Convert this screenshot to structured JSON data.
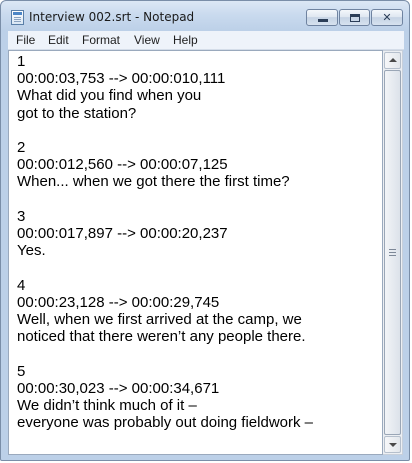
{
  "window": {
    "title": "Interview 002.srt - Notepad",
    "app_icon": "notepad-icon"
  },
  "title_buttons": {
    "minimize_icon": "minimize-icon",
    "maximize_icon": "maximize-icon",
    "close_icon": "close-icon",
    "close_glyph": "✕"
  },
  "menu": {
    "items": [
      {
        "label": "File"
      },
      {
        "label": "Edit"
      },
      {
        "label": "Format"
      },
      {
        "label": "View"
      },
      {
        "label": "Help"
      }
    ]
  },
  "document": {
    "text": "1\n00:00:03,753 --> 00:00:010,111\nWhat did you find when you\ngot to the station?\n\n2\n00:00:012,560 --> 00:00:07,125\nWhen... when we got there the first time?\n\n3\n00:00:017,897 --> 00:00:20,237\nYes.\n\n4\n00:00:23,128 --> 00:00:29,745\nWell, when we first arrived at the camp, we\nnoticed that there weren’t any people there.\n\n5\n00:00:30,023 --> 00:00:34,671\nWe didn’t think much of it –\neveryone was probably out doing fieldwork –"
  },
  "scrollbar": {
    "up_icon": "scroll-up-arrow-icon",
    "down_icon": "scroll-down-arrow-icon"
  },
  "colors": {
    "titlebar": "#c9daee",
    "menubar": "#eef3fa",
    "editor_bg": "#ffffff",
    "text": "#000000"
  }
}
